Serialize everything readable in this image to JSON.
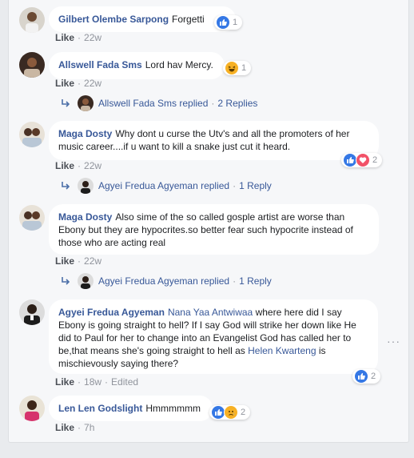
{
  "comments": [
    {
      "name": "Gilbert Olembe Sarpong",
      "text": "Forgetti",
      "reactions_count": "1",
      "like": "Like",
      "time": "22w"
    },
    {
      "name": "Allswell Fada Sms",
      "text": "Lord hav Mercy.",
      "reactions_count": "1",
      "like": "Like",
      "time": "22w",
      "reply": {
        "name": "Allswell Fada Sms replied",
        "count": "2 Replies"
      }
    },
    {
      "name": "Maga Dosty",
      "text": "Why dont u curse the Utv's and all the promoters of her music career....if u want to kill a snake just cut it heard.",
      "reactions_count": "2",
      "like": "Like",
      "time": "22w",
      "reply": {
        "name": "Agyei Fredua Agyeman replied",
        "count": "1 Reply"
      }
    },
    {
      "name": "Maga Dosty",
      "text": "Also sime of the so called gosple artist are worse than Ebony but they are hypocrites.so better fear such hypocrite instead of those who are acting real",
      "like": "Like",
      "time": "22w",
      "reply": {
        "name": "Agyei Fredua Agyeman replied",
        "count": "1 Reply"
      }
    },
    {
      "name": "Agyei Fredua Agyeman",
      "mention1": "Nana Yaa Antwiwaa",
      "text_a": "where here did I say Ebony is going straight to hell? If I say God will strike her down like He did to Paul for her to change into an Evangelist God has called her to be,that means she's going straight to hell as",
      "mention2": "Helen Kwarteng",
      "text_b": "is mischievously saying there?",
      "reactions_count": "2",
      "like": "Like",
      "time": "18w",
      "edited": "Edited"
    },
    {
      "name": "Len Len Godslight",
      "text": "Hmmmmmm",
      "reactions_count": "2",
      "like": "Like",
      "time": "7h"
    }
  ],
  "separator": "·",
  "more_label": "···",
  "colors": {
    "link": "#385898",
    "meta": "#90949c",
    "like_blue": "#3578e5",
    "love_red": "#f25268",
    "emoji_yellow": "#f7b125"
  }
}
